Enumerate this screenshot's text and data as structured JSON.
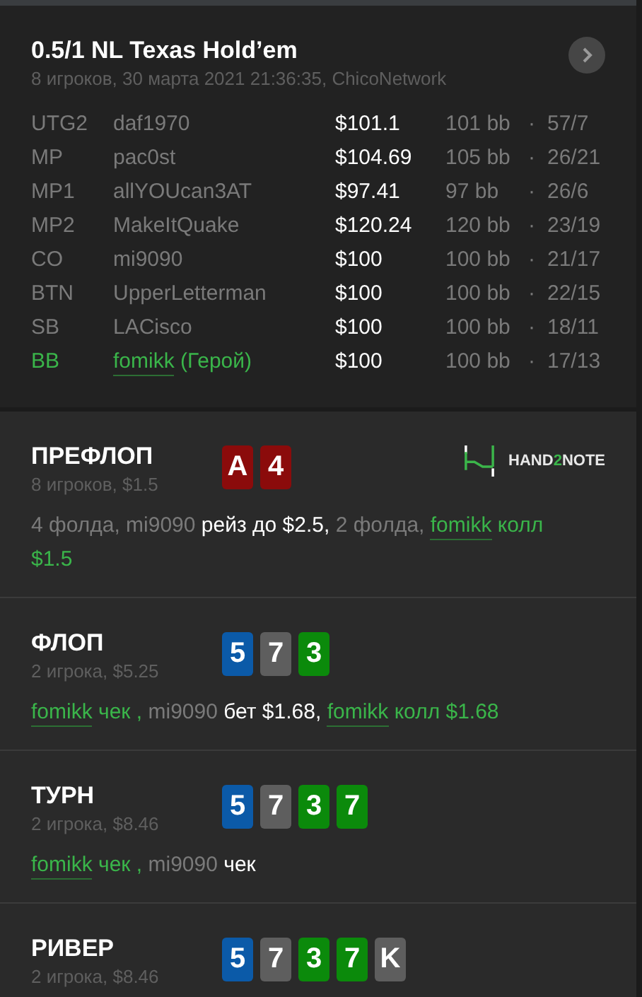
{
  "header": {
    "title": "0.5/1 NL Texas Hold’em",
    "subtitle": "8 игроков, 30 марта 2021 21:36:35, ChicoNetwork"
  },
  "players": [
    {
      "position": "UTG2",
      "name": "daf1970",
      "hero": false,
      "stack": "$101.1",
      "bb": "101 bb",
      "sep": "·",
      "stats": "57/7"
    },
    {
      "position": "MP",
      "name": "pac0st",
      "hero": false,
      "stack": "$104.69",
      "bb": "105 bb",
      "sep": "·",
      "stats": "26/21"
    },
    {
      "position": "MP1",
      "name": "allYOUcan3AT",
      "hero": false,
      "stack": "$97.41",
      "bb": "97 bb",
      "sep": "·",
      "stats": "26/6"
    },
    {
      "position": "MP2",
      "name": "MakeItQuake",
      "hero": false,
      "stack": "$120.24",
      "bb": "120 bb",
      "sep": "·",
      "stats": "23/19"
    },
    {
      "position": "CO",
      "name": "mi9090",
      "hero": false,
      "stack": "$100",
      "bb": "100 bb",
      "sep": "·",
      "stats": "21/17"
    },
    {
      "position": "BTN",
      "name": "UpperLetterman",
      "hero": false,
      "stack": "$100",
      "bb": "100 bb",
      "sep": "·",
      "stats": "22/15"
    },
    {
      "position": "SB",
      "name": "LACisco",
      "hero": false,
      "stack": "$100",
      "bb": "100 bb",
      "sep": "·",
      "stats": "18/11"
    },
    {
      "position": "BB",
      "name": "fomikk",
      "hero": true,
      "hero_label": "(Герой)",
      "stack": "$100",
      "bb": "100 bb",
      "sep": "·",
      "stats": "17/13"
    }
  ],
  "logo": {
    "before": "HAND",
    "accent": "2",
    "after": "NOTE"
  },
  "streets": [
    {
      "title": "ПРЕФЛОП",
      "subtitle": "8 игроков, $1.5",
      "cards": [
        {
          "rank": "A",
          "color": "#8b0b0b"
        },
        {
          "rank": "4",
          "color": "#8b0b0b"
        }
      ],
      "actions": [
        {
          "kind": "plain",
          "text": "4 фолда, mi9090 "
        },
        {
          "kind": "action",
          "text": "рейз до $2.5,"
        },
        {
          "kind": "plain",
          "text": " 2 фолда, "
        },
        {
          "kind": "hero-link",
          "text": "fomikk"
        },
        {
          "kind": "hero",
          "text": " колл $1.5"
        }
      ]
    },
    {
      "title": "ФЛОП",
      "subtitle": "2 игрока, $5.25",
      "cards": [
        {
          "rank": "5",
          "color": "#0b5aa8"
        },
        {
          "rank": "7",
          "color": "#5e5e5e"
        },
        {
          "rank": "3",
          "color": "#0b8a0b"
        }
      ],
      "actions": [
        {
          "kind": "hero-link",
          "text": "fomikk"
        },
        {
          "kind": "hero",
          "text": " чек ,"
        },
        {
          "kind": "plain",
          "text": " mi9090 "
        },
        {
          "kind": "action",
          "text": "бет $1.68, "
        },
        {
          "kind": "hero-link",
          "text": "fomikk"
        },
        {
          "kind": "hero",
          "text": " колл $1.68"
        }
      ]
    },
    {
      "title": "ТУРН",
      "subtitle": "2 игрока, $8.46",
      "cards": [
        {
          "rank": "5",
          "color": "#0b5aa8"
        },
        {
          "rank": "7",
          "color": "#5e5e5e"
        },
        {
          "rank": "3",
          "color": "#0b8a0b"
        },
        {
          "rank": "7",
          "color": "#0b8a0b"
        }
      ],
      "actions": [
        {
          "kind": "hero-link",
          "text": "fomikk"
        },
        {
          "kind": "hero",
          "text": " чек ,"
        },
        {
          "kind": "plain",
          "text": " mi9090 "
        },
        {
          "kind": "action",
          "text": "чек"
        }
      ]
    },
    {
      "title": "РИВЕР",
      "subtitle": "2 игрока, $8.46",
      "cards": [
        {
          "rank": "5",
          "color": "#0b5aa8"
        },
        {
          "rank": "7",
          "color": "#5e5e5e"
        },
        {
          "rank": "3",
          "color": "#0b8a0b"
        },
        {
          "rank": "7",
          "color": "#0b8a0b"
        },
        {
          "rank": "K",
          "color": "#5e5e5e"
        }
      ]
    }
  ]
}
